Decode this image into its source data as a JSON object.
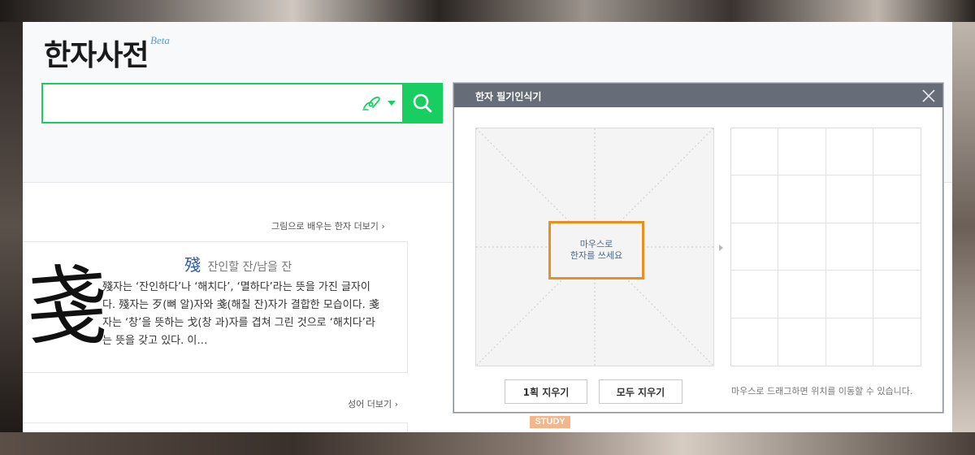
{
  "header": {
    "logo": "한자사전",
    "beta": "Beta"
  },
  "search": {
    "value": "",
    "placeholder": ""
  },
  "main": {
    "picture_more": "그림으로 배우는 한자 더보기 ›",
    "idiom_more": "성어 더보기 ›",
    "card": {
      "glyph": "戔",
      "hanja": "殘",
      "meaning": "잔인할 잔/남을 잔",
      "description": "殘자는 ‘잔인하다’나 ‘해치다’, ‘멸하다’라는 뜻을 가진 글자이다. 殘자는 歹(뼈 알)자와 戔(해칠 잔)자가 결합한 모습이다. 戔자는 ‘창’을 뜻하는 戈(창 과)자를 겹쳐 그린 것으로 ‘해치다’라는 뜻을 갖고 있다. 이…"
    },
    "study_badge": "STUDY"
  },
  "popup": {
    "title": "한자 필기인식기",
    "hint_line1": "마우스로",
    "hint_line2": "한자를 쓰세요",
    "btn_undo": "1획 지우기",
    "btn_clear": "모두 지우기",
    "note": "마우스로 드래그하면 위치를 이동할 수 있습니다."
  },
  "colors": {
    "accent": "#19ce60",
    "popup_header": "#676d78",
    "hint_border": "#e88f22"
  }
}
